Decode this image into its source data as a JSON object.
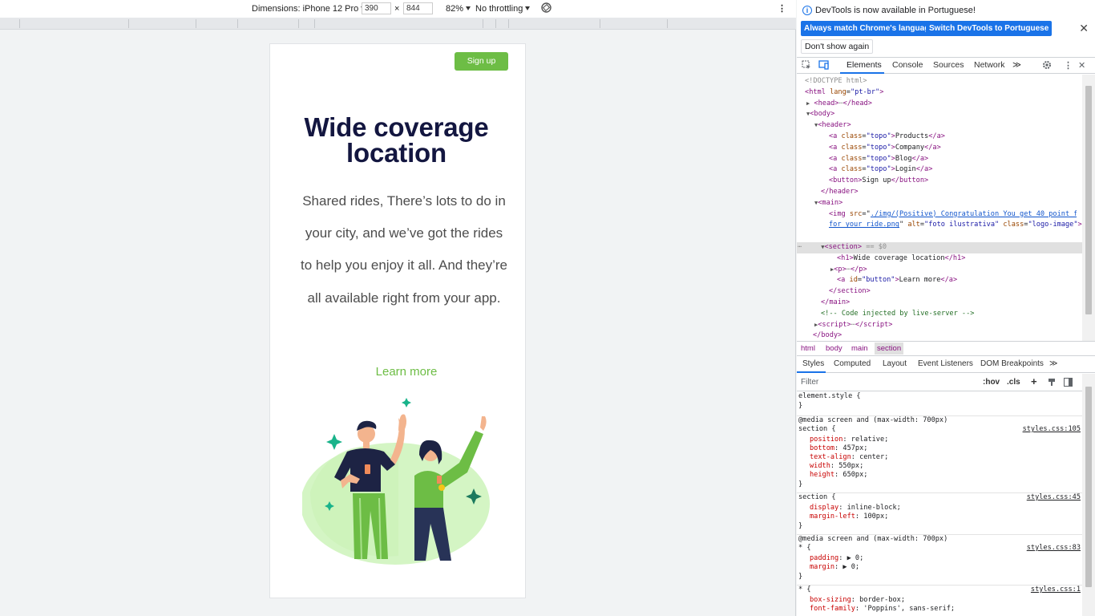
{
  "device_toolbar": {
    "dimensions_label": "Dimensions: iPhone 12 Pro",
    "width": "390",
    "times": "×",
    "height": "844",
    "zoom": "82%",
    "throttling": "No throttling",
    "more": "⋮"
  },
  "page": {
    "signup_label": "Sign up",
    "title": "Wide coverage location",
    "paragraph": "Shared rides, There’s lots to do in your city, and we’ve got the rides to help you enjoy it all. And they’re all available right from your app.",
    "learn_more": "Learn more"
  },
  "devtools": {
    "infobar": {
      "message": "DevTools is now available in Portuguese!",
      "btn_match": "Always match Chrome's language",
      "btn_switch": "Switch DevTools to Portuguese",
      "btn_dont_show": "Don't show again",
      "close": "✕"
    },
    "tabs": [
      "Elements",
      "Console",
      "Sources",
      "Network",
      "≫"
    ],
    "dom": {
      "doctype": "<!DOCTYPE html>",
      "html_open_tag": "html",
      "html_lang_attr": "lang",
      "html_lang_val": "\"pt-br\"",
      "head": "head",
      "body": "body",
      "header": "header",
      "links": [
        "Products",
        "Company",
        "Blog",
        "Login"
      ],
      "a_class_attr": "class",
      "a_class_val": "\"topo\"",
      "button_text": "Sign up",
      "main": "main",
      "img_src_attr": "src",
      "img_src_val": "./img/(Positive) Congratulation You get 40 point for your ride.png",
      "img_alt_attr": "alt",
      "img_alt_val": "\"foto ilustrativa\"",
      "img_class_val": "\"logo-image\"",
      "section": "section",
      "selected_marker": "== $0",
      "h1_text": "Wide coverage location",
      "a_id_attr": "id",
      "a_id_val": "\"button\"",
      "a_text": "Learn more",
      "comment": "<!-- Code injected by live-server -->",
      "script": "script"
    },
    "breadcrumbs": [
      "html",
      "body",
      "main",
      "section"
    ],
    "subtabs": [
      "Styles",
      "Computed",
      "Layout",
      "Event Listeners",
      "DOM Breakpoints",
      "≫"
    ],
    "filter": {
      "placeholder": "Filter",
      "hov": ":hov",
      "cls": ".cls"
    },
    "styles": {
      "element_style": "element.style {",
      "close": "}",
      "media1": "@media screen and (max-width: 700px)",
      "section_sel": "section {",
      "src1": "styles.css:105",
      "props1": [
        {
          "name": "position",
          "value": "relative;"
        },
        {
          "name": "bottom",
          "value": "457px;"
        },
        {
          "name": "text-align",
          "value": "center;"
        },
        {
          "name": "width",
          "value": "550px;"
        },
        {
          "name": "height",
          "value": "650px;"
        }
      ],
      "src2": "styles.css:45",
      "props2": [
        {
          "name": "display",
          "value": "inline-block;"
        },
        {
          "name": "margin-left",
          "value": "100px;"
        }
      ],
      "media2": "@media screen and (max-width: 700px)",
      "star_sel": "* {",
      "src3": "styles.css:83",
      "props3": [
        {
          "name": "padding",
          "value": "▶ 0;"
        },
        {
          "name": "margin",
          "value": "▶ 0;"
        }
      ],
      "src4": "styles.css:1",
      "props4": [
        {
          "name": "box-sizing",
          "value": "border-box;"
        },
        {
          "name": "font-family",
          "value": "'Poppins', sans-serif;"
        }
      ]
    }
  },
  "colors": {
    "brand_green": "#6dbd45",
    "title_navy": "#131640",
    "devtools_blue": "#1a73e8"
  }
}
